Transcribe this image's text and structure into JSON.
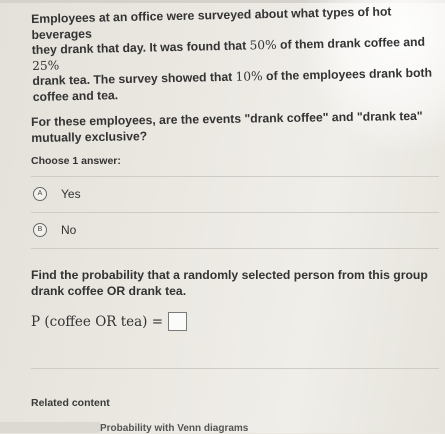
{
  "problem": {
    "line1": "Employees at an office were surveyed about what types of hot beverages",
    "line2_pre": "they drank that day. It was found that ",
    "line2_pct": "50%",
    "line2_post": " of them drank coffee and ",
    "line2_pct2": "25%",
    "line3": "drank tea. The survey showed that ",
    "line3_pct": "10%",
    "line3_post": " of the employees drank both",
    "line4": "coffee and tea."
  },
  "question": {
    "line1": "For these employees, are the events \"drank coffee\" and \"drank tea\"",
    "line2": "mutually exclusive?"
  },
  "choose_label": "Choose 1 answer:",
  "choices": [
    {
      "letter": "A",
      "label": "Yes"
    },
    {
      "letter": "B",
      "label": "No"
    }
  ],
  "prob_question": {
    "line1": "Find the probability that a randomly selected person from this group",
    "line2": "drank coffee OR drank tea."
  },
  "formula": {
    "lhs": "P (coffee OR tea) ="
  },
  "related": {
    "heading": "Related content",
    "link": "Probability with Venn diagrams"
  }
}
